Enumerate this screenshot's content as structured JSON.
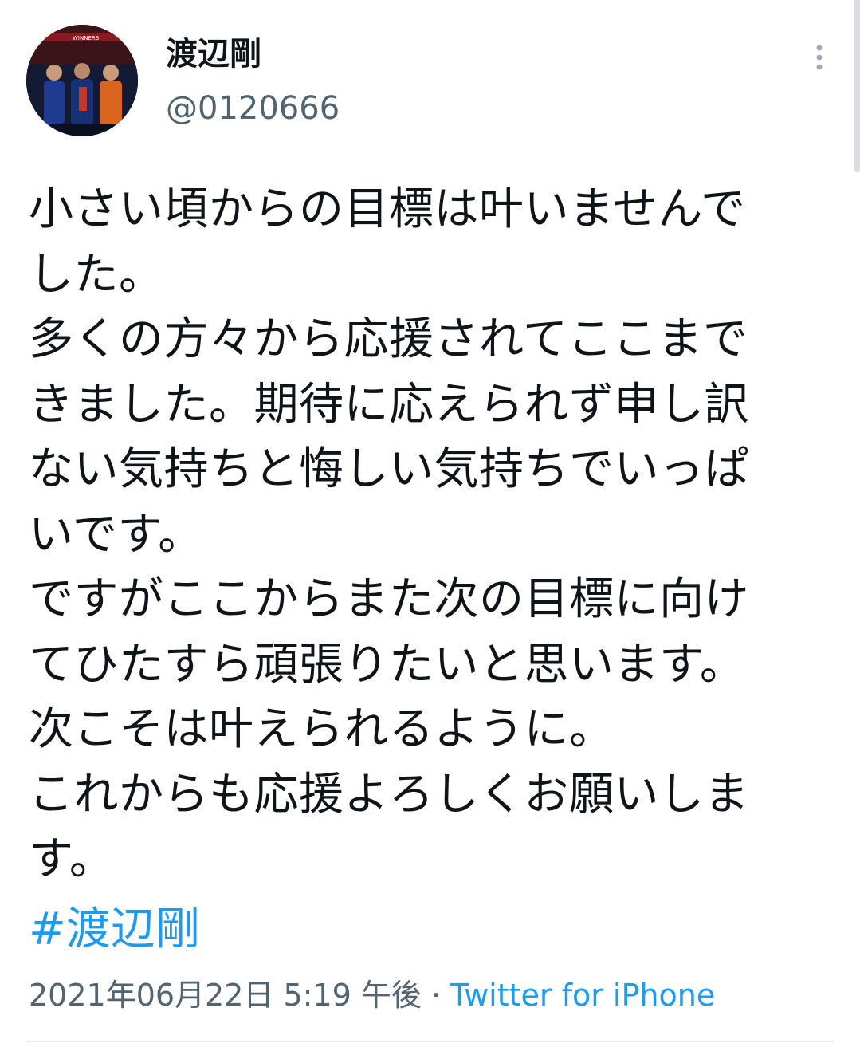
{
  "user": {
    "display_name": "渡辺剛",
    "handle": "@0120666",
    "avatar_icon": "profile-photo-avatar",
    "avatar_banner_text": "WINNERS"
  },
  "tweet": {
    "lines": [
      "小さい頃からの目標は叶いませんで",
      "した。",
      "多くの方々から応援されてここまで",
      "きました。期待に応えられず申し訳",
      "ない気持ちと悔しい気持ちでいっぱ",
      "いです。",
      "ですがここからまた次の目標に向け",
      "てひたすら頑張りたいと思います。",
      "次こそは叶えられるように。",
      "これからも応援よろしくお願いしま",
      "す。"
    ],
    "hashtag": "#渡辺剛",
    "timestamp": "2021年06月22日 5:19 午後",
    "separator": " · ",
    "source": "Twitter for iPhone"
  },
  "icons": {
    "more": "more-vertical-icon"
  },
  "colors": {
    "text": "#0f1419",
    "secondary": "#536471",
    "link": "#1d9bf0",
    "divider": "#e6e9ec"
  }
}
